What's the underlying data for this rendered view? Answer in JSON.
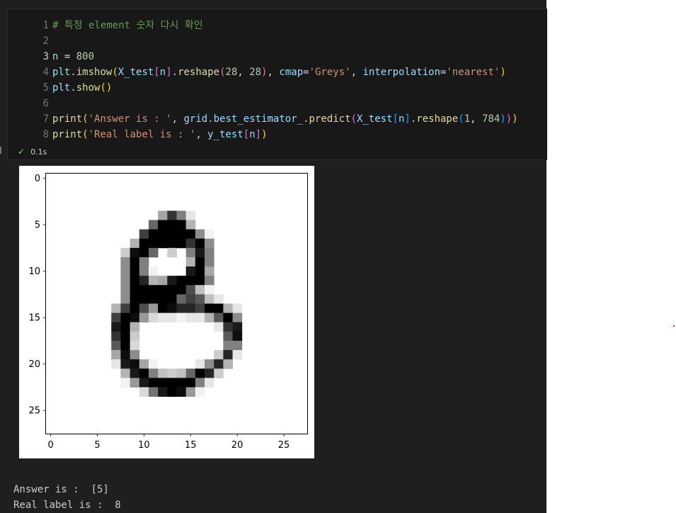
{
  "cell": {
    "lines": [
      {
        "num": "1",
        "active": false,
        "tokens": [
          [
            "tok-comment",
            "# 특정 element 숫자 다시 확인"
          ]
        ]
      },
      {
        "num": "2",
        "active": false,
        "tokens": []
      },
      {
        "num": "3",
        "active": true,
        "tokens": [
          [
            "tok-var",
            "n"
          ],
          [
            "tok-op",
            " = "
          ],
          [
            "tok-num",
            "800"
          ]
        ]
      },
      {
        "num": "4",
        "active": false,
        "tokens": [
          [
            "tok-var",
            "plt"
          ],
          [
            "tok-punct",
            "."
          ],
          [
            "tok-fn",
            "imshow"
          ],
          [
            "tok-paren1",
            "("
          ],
          [
            "tok-var",
            "X_test"
          ],
          [
            "tok-paren2",
            "["
          ],
          [
            "tok-var",
            "n"
          ],
          [
            "tok-paren2",
            "]"
          ],
          [
            "tok-punct",
            "."
          ],
          [
            "tok-fn",
            "reshape"
          ],
          [
            "tok-paren2",
            "("
          ],
          [
            "tok-num",
            "28"
          ],
          [
            "tok-punct",
            ", "
          ],
          [
            "tok-num",
            "28"
          ],
          [
            "tok-paren2",
            ")"
          ],
          [
            "tok-punct",
            ", "
          ],
          [
            "tok-var",
            "cmap"
          ],
          [
            "tok-op",
            "="
          ],
          [
            "tok-str",
            "'Greys'"
          ],
          [
            "tok-punct",
            ", "
          ],
          [
            "tok-var",
            "interpolation"
          ],
          [
            "tok-op",
            "="
          ],
          [
            "tok-str",
            "'nearest'"
          ],
          [
            "tok-paren1",
            ")"
          ]
        ]
      },
      {
        "num": "5",
        "active": false,
        "tokens": [
          [
            "tok-var",
            "plt"
          ],
          [
            "tok-punct",
            "."
          ],
          [
            "tok-fn",
            "show"
          ],
          [
            "tok-paren1",
            "()"
          ]
        ]
      },
      {
        "num": "6",
        "active": false,
        "tokens": []
      },
      {
        "num": "7",
        "active": false,
        "tokens": [
          [
            "tok-fn",
            "print"
          ],
          [
            "tok-paren1",
            "("
          ],
          [
            "tok-str",
            "'Answer is : '"
          ],
          [
            "tok-punct",
            ", "
          ],
          [
            "tok-var",
            "grid"
          ],
          [
            "tok-punct",
            "."
          ],
          [
            "tok-var",
            "best_estimator_"
          ],
          [
            "tok-punct",
            "."
          ],
          [
            "tok-fn",
            "predict"
          ],
          [
            "tok-paren2",
            "("
          ],
          [
            "tok-var",
            "X_test"
          ],
          [
            "tok-paren3",
            "["
          ],
          [
            "tok-var",
            "n"
          ],
          [
            "tok-paren3",
            "]"
          ],
          [
            "tok-punct",
            "."
          ],
          [
            "tok-fn",
            "reshape"
          ],
          [
            "tok-paren3",
            "("
          ],
          [
            "tok-num",
            "1"
          ],
          [
            "tok-punct",
            ", "
          ],
          [
            "tok-num",
            "784"
          ],
          [
            "tok-paren3",
            ")"
          ],
          [
            "tok-paren2",
            ")"
          ],
          [
            "tok-paren1",
            ")"
          ]
        ]
      },
      {
        "num": "8",
        "active": false,
        "tokens": [
          [
            "tok-fn",
            "print"
          ],
          [
            "tok-paren1",
            "("
          ],
          [
            "tok-str",
            "'Real label is : '"
          ],
          [
            "tok-punct",
            ", "
          ],
          [
            "tok-var",
            "y_test"
          ],
          [
            "tok-paren2",
            "["
          ],
          [
            "tok-var",
            "n"
          ],
          [
            "tok-paren2",
            "]"
          ],
          [
            "tok-paren1",
            ")"
          ]
        ]
      }
    ],
    "exec_time": "0.1s"
  },
  "chart_data": {
    "type": "heatmap",
    "colormap": "Greys",
    "xlim": [
      -0.5,
      27.5
    ],
    "ylim": [
      27.5,
      -0.5
    ],
    "xticks": [
      0,
      5,
      10,
      15,
      20,
      25
    ],
    "yticks": [
      0,
      5,
      10,
      15,
      20,
      25
    ],
    "pixels": [
      "............................",
      "............................",
      "............................",
      "............................",
      "............................",
      "............................",
      "............................",
      "............................",
      "............................",
      "............................",
      "............................",
      "............................",
      "............................",
      "............................",
      "............................",
      "............................",
      "............................",
      "............................",
      "............................",
      "............................",
      "............................",
      "............................",
      "............................",
      "............................",
      "............................",
      "............................",
      "............................",
      "............................"
    ],
    "rows": [
      [
        0,
        0,
        0,
        0,
        0,
        0,
        0,
        0,
        0,
        0,
        0,
        0,
        0,
        0,
        0,
        0,
        0,
        0,
        0,
        0,
        0,
        0,
        0,
        0,
        0,
        0,
        0,
        0
      ],
      [
        0,
        0,
        0,
        0,
        0,
        0,
        0,
        0,
        0,
        0,
        0,
        0,
        0,
        0,
        0,
        0,
        0,
        0,
        0,
        0,
        0,
        0,
        0,
        0,
        0,
        0,
        0,
        0
      ],
      [
        0,
        0,
        0,
        0,
        0,
        0,
        0,
        0,
        0,
        0,
        0,
        0,
        0,
        0,
        0,
        0,
        0,
        0,
        0,
        0,
        0,
        0,
        0,
        0,
        0,
        0,
        0,
        0
      ],
      [
        0,
        0,
        0,
        0,
        0,
        0,
        0,
        0,
        0,
        0,
        0,
        0,
        0,
        0,
        0,
        0,
        0,
        0,
        0,
        0,
        0,
        0,
        0,
        0,
        0,
        0,
        0,
        0
      ],
      [
        0,
        0,
        0,
        0,
        0,
        0,
        0,
        0,
        0,
        0,
        0,
        0,
        0.35,
        0.8,
        0.5,
        0.1,
        0,
        0,
        0,
        0,
        0,
        0,
        0,
        0,
        0,
        0,
        0,
        0
      ],
      [
        0,
        0,
        0,
        0,
        0,
        0,
        0,
        0,
        0,
        0,
        0,
        0.6,
        1,
        1,
        1,
        0.3,
        0,
        0,
        0,
        0,
        0,
        0,
        0,
        0,
        0,
        0,
        0,
        0
      ],
      [
        0,
        0,
        0,
        0,
        0,
        0,
        0,
        0,
        0,
        0,
        0.75,
        1,
        1,
        1,
        1,
        1,
        0.45,
        0.05,
        0,
        0,
        0,
        0,
        0,
        0,
        0,
        0,
        0,
        0
      ],
      [
        0,
        0,
        0,
        0,
        0,
        0,
        0,
        0,
        0,
        0.3,
        1,
        1,
        1,
        1,
        1,
        0.8,
        1,
        0.45,
        0,
        0,
        0,
        0,
        0,
        0,
        0,
        0,
        0,
        0
      ],
      [
        0,
        0,
        0,
        0,
        0,
        0,
        0,
        0,
        0.2,
        0.95,
        1,
        0.6,
        0,
        0.2,
        0,
        0.5,
        0.9,
        0.5,
        0,
        0,
        0,
        0,
        0,
        0,
        0,
        0,
        0,
        0
      ],
      [
        0,
        0,
        0,
        0,
        0,
        0,
        0,
        0,
        0.45,
        1,
        0.5,
        0,
        0,
        0,
        0,
        0.3,
        1,
        0.5,
        0,
        0,
        0,
        0,
        0,
        0,
        0,
        0,
        0,
        0
      ],
      [
        0,
        0,
        0,
        0,
        0,
        0,
        0,
        0,
        0.45,
        1,
        0.5,
        0.05,
        0,
        0,
        0,
        0.9,
        1,
        0.35,
        0,
        0,
        0,
        0,
        0,
        0,
        0,
        0,
        0,
        0
      ],
      [
        0,
        0,
        0,
        0,
        0,
        0,
        0,
        0,
        0.45,
        1,
        0.85,
        0.3,
        0.35,
        0.9,
        1,
        1,
        1,
        0.5,
        0,
        0,
        0,
        0,
        0,
        0,
        0,
        0,
        0,
        0
      ],
      [
        0,
        0,
        0,
        0,
        0,
        0,
        0,
        0,
        0.45,
        1,
        1,
        1,
        1,
        1,
        1,
        0.7,
        0.25,
        0.05,
        0,
        0,
        0,
        0,
        0,
        0,
        0,
        0,
        0,
        0
      ],
      [
        0,
        0,
        0,
        0,
        0,
        0,
        0,
        0,
        0.45,
        1,
        1,
        1,
        1,
        1,
        0.6,
        0.75,
        0.65,
        0.25,
        0.1,
        0,
        0,
        0,
        0,
        0,
        0,
        0,
        0,
        0
      ],
      [
        0,
        0,
        0,
        0,
        0,
        0,
        0,
        0.3,
        0.75,
        1,
        0.7,
        0.4,
        1,
        0.95,
        0.85,
        0.85,
        0.75,
        1,
        1,
        0.3,
        0.1,
        0,
        0,
        0,
        0,
        0,
        0,
        0
      ],
      [
        0,
        0,
        0,
        0,
        0,
        0,
        0,
        0.75,
        1,
        0.95,
        0.4,
        0.15,
        0.1,
        0.1,
        0.05,
        0.1,
        0.1,
        0.3,
        0.65,
        1,
        0.45,
        0,
        0,
        0,
        0,
        0,
        0,
        0
      ],
      [
        0,
        0,
        0,
        0,
        0,
        0,
        0,
        0.9,
        1,
        0.3,
        0,
        0,
        0,
        0,
        0,
        0,
        0,
        0,
        0.1,
        0.8,
        0.9,
        0,
        0,
        0,
        0,
        0,
        0,
        0
      ],
      [
        0,
        0,
        0,
        0,
        0,
        0,
        0,
        0.8,
        1,
        0.2,
        0,
        0,
        0,
        0,
        0,
        0,
        0,
        0,
        0,
        0.65,
        0.95,
        0,
        0,
        0,
        0,
        0,
        0,
        0
      ],
      [
        0,
        0,
        0,
        0,
        0,
        0,
        0,
        0.65,
        1,
        0.15,
        0,
        0,
        0,
        0,
        0,
        0,
        0,
        0,
        0,
        0.5,
        0.5,
        0,
        0,
        0,
        0,
        0,
        0,
        0
      ],
      [
        0,
        0,
        0,
        0,
        0,
        0,
        0,
        0.35,
        0.95,
        0.45,
        0,
        0,
        0,
        0,
        0,
        0,
        0,
        0,
        0.2,
        0.85,
        0.1,
        0,
        0,
        0,
        0,
        0,
        0,
        0
      ],
      [
        0,
        0,
        0,
        0,
        0,
        0,
        0,
        0.1,
        0.9,
        0.95,
        0.35,
        0.05,
        0,
        0,
        0,
        0,
        0.1,
        0.45,
        0.85,
        0.3,
        0,
        0,
        0,
        0,
        0,
        0,
        0,
        0
      ],
      [
        0,
        0,
        0,
        0,
        0,
        0,
        0,
        0,
        0.3,
        0.9,
        1,
        0.5,
        0.25,
        0.2,
        0.25,
        0.6,
        1,
        0.85,
        0.2,
        0,
        0,
        0,
        0,
        0,
        0,
        0,
        0,
        0
      ],
      [
        0,
        0,
        0,
        0,
        0,
        0,
        0,
        0,
        0.05,
        0.4,
        0.9,
        1,
        1,
        1,
        1,
        1,
        0.5,
        0.1,
        0,
        0,
        0,
        0,
        0,
        0,
        0,
        0,
        0,
        0
      ],
      [
        0,
        0,
        0,
        0,
        0,
        0,
        0,
        0,
        0,
        0,
        0.15,
        0.55,
        0.9,
        1,
        0.95,
        0.4,
        0.05,
        0,
        0,
        0,
        0,
        0,
        0,
        0,
        0,
        0,
        0,
        0
      ],
      [
        0,
        0,
        0,
        0,
        0,
        0,
        0,
        0,
        0,
        0,
        0,
        0,
        0,
        0,
        0,
        0,
        0,
        0,
        0,
        0,
        0,
        0,
        0,
        0,
        0,
        0,
        0,
        0
      ],
      [
        0,
        0,
        0,
        0,
        0,
        0,
        0,
        0,
        0,
        0,
        0,
        0,
        0,
        0,
        0,
        0,
        0,
        0,
        0,
        0,
        0,
        0,
        0,
        0,
        0,
        0,
        0,
        0
      ],
      [
        0,
        0,
        0,
        0,
        0,
        0,
        0,
        0,
        0,
        0,
        0,
        0,
        0,
        0,
        0,
        0,
        0,
        0,
        0,
        0,
        0,
        0,
        0,
        0,
        0,
        0,
        0,
        0
      ],
      [
        0,
        0,
        0,
        0,
        0,
        0,
        0,
        0,
        0,
        0,
        0,
        0,
        0,
        0,
        0,
        0,
        0,
        0,
        0,
        0,
        0,
        0,
        0,
        0,
        0,
        0,
        0,
        0
      ]
    ]
  },
  "output": {
    "answer_line": "Answer is :  [5]",
    "label_line": "Real label is :  8"
  }
}
